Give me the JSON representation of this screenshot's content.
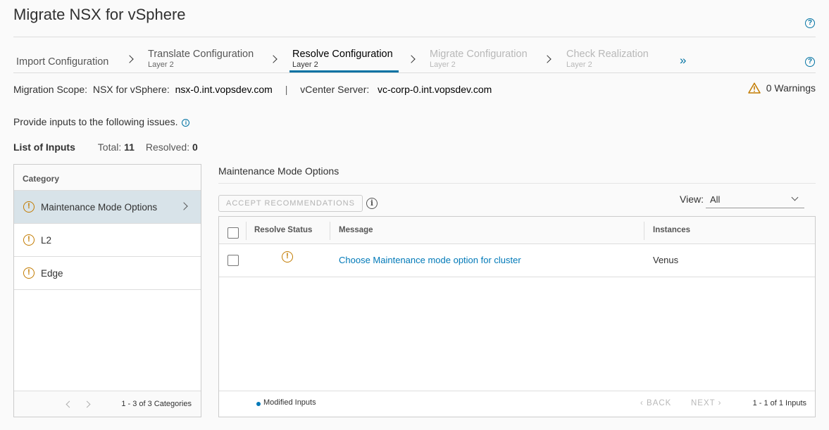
{
  "page": {
    "title": "Migrate NSX for vSphere",
    "help_glyph": "?"
  },
  "stepper": {
    "steps": [
      {
        "label": "Import Configuration",
        "sub": "",
        "state": "done"
      },
      {
        "label": "Translate Configuration",
        "sub": "Layer 2",
        "state": "done"
      },
      {
        "label": "Resolve Configuration",
        "sub": "Layer 2",
        "state": "active"
      },
      {
        "label": "Migrate Configuration",
        "sub": "Layer 2",
        "state": "future"
      },
      {
        "label": "Check Realization",
        "sub": "Layer 2",
        "state": "future"
      }
    ],
    "more_glyph": "»"
  },
  "scope": {
    "label": "Migration Scope:",
    "nsx_label": "NSX for vSphere:",
    "nsx_value": "nsx-0.int.vopsdev.com",
    "separator": "|",
    "vc_label": "vCenter Server:",
    "vc_value": "vc-corp-0.int.vopsdev.com",
    "warnings": "0 Warnings"
  },
  "instructions": {
    "text": "Provide inputs to the following issues.",
    "info_glyph": "i"
  },
  "list": {
    "title": "List of Inputs",
    "total_label": "Total:",
    "total_value": "11",
    "resolved_label": "Resolved:",
    "resolved_value": "0"
  },
  "categories": {
    "header": "Category",
    "items": [
      {
        "label": "Maintenance Mode Options",
        "selected": true
      },
      {
        "label": "L2",
        "selected": false
      },
      {
        "label": "Edge",
        "selected": false
      }
    ],
    "pager": "1 - 3 of 3 Categories"
  },
  "detail": {
    "title": "Maintenance Mode Options",
    "accept_button": "ACCEPT RECOMMENDATIONS",
    "view_label": "View:",
    "view_value": "All",
    "columns": {
      "resolve_status": "Resolve Status",
      "message": "Message",
      "instances": "Instances"
    },
    "rows": [
      {
        "message": "Choose Maintenance mode option for cluster",
        "instances": "Venus"
      }
    ],
    "legend": "Modified Inputs",
    "back": "BACK",
    "next": "NEXT",
    "pager": "1 - 1 of 1 Inputs"
  },
  "colors": {
    "accent": "#0072a3",
    "link": "#0079b8",
    "warning": "#c27b00",
    "selected_row": "#d8e3e9"
  }
}
